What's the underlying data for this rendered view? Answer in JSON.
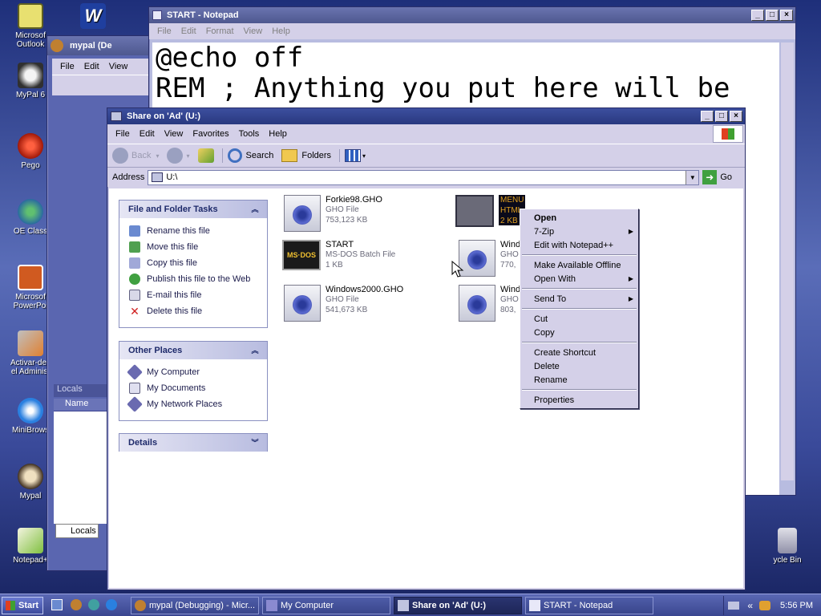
{
  "desktop_icons": [
    {
      "label": "Microsoft Outlook",
      "line1": "Microsof",
      "line2": "Outlook"
    },
    {
      "label": "W",
      "line1": "",
      "line2": ""
    },
    {
      "label": "MyPal 6",
      "line1": "MyPal 6",
      "line2": ""
    },
    {
      "label": "Pego",
      "line1": "Pego",
      "line2": ""
    },
    {
      "label": "OE Class",
      "line1": "OE Class",
      "line2": ""
    },
    {
      "label": "Microsoft PowerPoint",
      "line1": "Microsof",
      "line2": "PowerPoi"
    },
    {
      "label": "Activar-des el Administ",
      "line1": "Activar-des",
      "line2": "el Administ"
    },
    {
      "label": "MiniBrowser",
      "line1": "MiniBrows",
      "line2": ""
    },
    {
      "label": "Mypal",
      "line1": "Mypal",
      "line2": ""
    },
    {
      "label": "Notepad++",
      "line1": "Notepad+",
      "line2": ""
    },
    {
      "label": "Recycle Bin",
      "line1": "ycle Bin",
      "line2": ""
    }
  ],
  "mypal_window": {
    "title": "mypal (De",
    "menu": [
      "File",
      "Edit",
      "View"
    ],
    "panel_title": "Locals",
    "column": "Name",
    "tab": "Locals"
  },
  "notepad": {
    "title": "START - Notepad",
    "menu": [
      "File",
      "Edit",
      "Format",
      "View",
      "Help"
    ],
    "text": "@echo off\nREM ; Anything you put here will be"
  },
  "explorer": {
    "title": "Share on 'Ad' (U:)",
    "menu": [
      "File",
      "Edit",
      "View",
      "Favorites",
      "Tools",
      "Help"
    ],
    "toolbar": {
      "back": "Back",
      "search": "Search",
      "folders": "Folders"
    },
    "address_label": "Address",
    "address_value": "U:\\",
    "go_label": "Go",
    "file_tasks": {
      "title": "File and Folder Tasks",
      "items": [
        "Rename this file",
        "Move this file",
        "Copy this file",
        "Publish this file to the Web",
        "E-mail this file",
        "Delete this file"
      ]
    },
    "other_places": {
      "title": "Other Places",
      "items": [
        "My Computer",
        "My Documents",
        "My Network Places"
      ]
    },
    "details": {
      "title": "Details"
    },
    "files": [
      {
        "name": "Forkie98.GHO",
        "type": "GHO File",
        "size": "753,123 KB",
        "icon": "ghost-image-icon"
      },
      {
        "name": "START",
        "type": "MS-DOS Batch File",
        "size": "1 KB",
        "icon": "batch-file-icon"
      },
      {
        "name": "Windows2000.GHO",
        "type": "GHO File",
        "size": "541,673 KB",
        "icon": "ghost-image-icon"
      },
      {
        "name": "MENU",
        "type": "HTML",
        "size": "2 KB",
        "icon": "html-file-icon"
      },
      {
        "name": "Windo",
        "type": "GHO",
        "size": "770,",
        "icon": "ghost-image-icon"
      },
      {
        "name": "Windo",
        "type": "GHO",
        "size": "803,",
        "icon": "ghost-image-icon"
      }
    ]
  },
  "context_menu": {
    "items": [
      {
        "label": "Open",
        "bold": true,
        "submenu": false
      },
      {
        "label": "7-Zip",
        "bold": false,
        "submenu": true
      },
      {
        "label": "Edit with Notepad++",
        "bold": false,
        "submenu": false
      },
      {
        "sep": true
      },
      {
        "label": "Make Available Offline",
        "bold": false,
        "submenu": false
      },
      {
        "label": "Open With",
        "bold": false,
        "submenu": true
      },
      {
        "sep": true
      },
      {
        "label": "Send To",
        "bold": false,
        "submenu": true
      },
      {
        "sep": true
      },
      {
        "label": "Cut",
        "bold": false,
        "submenu": false
      },
      {
        "label": "Copy",
        "bold": false,
        "submenu": false
      },
      {
        "sep": true
      },
      {
        "label": "Create Shortcut",
        "bold": false,
        "submenu": false
      },
      {
        "label": "Delete",
        "bold": false,
        "submenu": false
      },
      {
        "label": "Rename",
        "bold": false,
        "submenu": false
      },
      {
        "sep": true
      },
      {
        "label": "Properties",
        "bold": false,
        "submenu": false
      }
    ]
  },
  "taskbar": {
    "start": "Start",
    "tasks": [
      "mypal (Debugging) - Micr...",
      "My Computer",
      "Share on 'Ad' (U:)",
      "START - Notepad"
    ],
    "active_task": 2,
    "clock": "5:56 PM"
  }
}
